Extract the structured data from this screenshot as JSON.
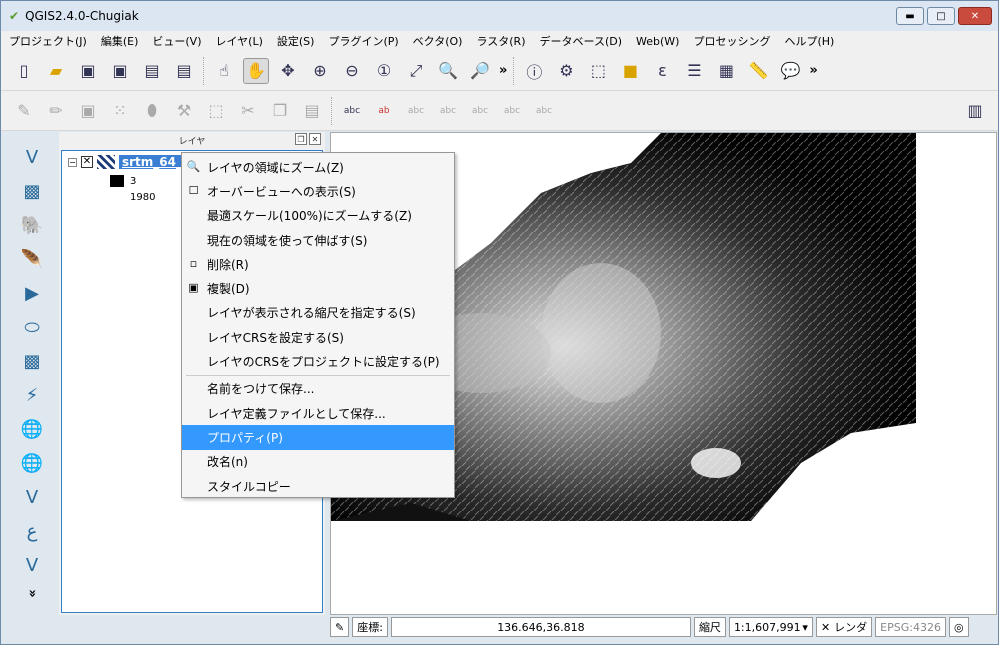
{
  "window": {
    "title": "QGIS2.4.0-Chugiak"
  },
  "menubar": [
    "プロジェクト(J)",
    "編集(E)",
    "ビュー(V)",
    "レイヤ(L)",
    "設定(S)",
    "プラグイン(P)",
    "ベクタ(O)",
    "ラスタ(R)",
    "データベース(D)",
    "Web(W)",
    "プロセッシング",
    "ヘルプ(H)"
  ],
  "toolbar_more": "»",
  "left_more": "»",
  "panel": {
    "title": "レイヤ",
    "layer_name": "srtm_64_0",
    "legend": [
      {
        "label": "3",
        "color": "#000000"
      },
      {
        "label": "1980",
        "color": "#ffffff"
      }
    ]
  },
  "context_menu": [
    {
      "label": "レイヤの領域にズーム(Z)",
      "icon": "zoom-layer-icon"
    },
    {
      "label": "オーバービューへの表示(S)",
      "icon": "checkbox-icon"
    },
    {
      "label": "最適スケール(100%)にズームする(Z)",
      "icon": ""
    },
    {
      "label": "現在の領域を使って伸ばす(S)",
      "icon": ""
    },
    {
      "label": "削除(R)",
      "icon": "remove-layer-icon"
    },
    {
      "label": "複製(D)",
      "icon": "duplicate-layer-icon"
    },
    {
      "label": "レイヤが表示される縮尺を指定する(S)",
      "icon": ""
    },
    {
      "label": "レイヤCRSを設定する(S)",
      "icon": ""
    },
    {
      "label": "レイヤのCRSをプロジェクトに設定する(P)",
      "icon": ""
    },
    {
      "label": "名前をつけて保存...",
      "icon": ""
    },
    {
      "label": "レイヤ定義ファイルとして保存...",
      "icon": ""
    },
    {
      "label": "プロパティ(P)",
      "icon": "",
      "selected": true
    },
    {
      "label": "改名(n)",
      "icon": ""
    },
    {
      "label": "スタイルコピー",
      "icon": ""
    }
  ],
  "status": {
    "coord_label": "座標:",
    "coordinate": "136.646,36.818",
    "scale_label": "縮尺",
    "scale": "1:1,607,991",
    "render_label": "レンダ",
    "crs": "EPSG:4326"
  }
}
